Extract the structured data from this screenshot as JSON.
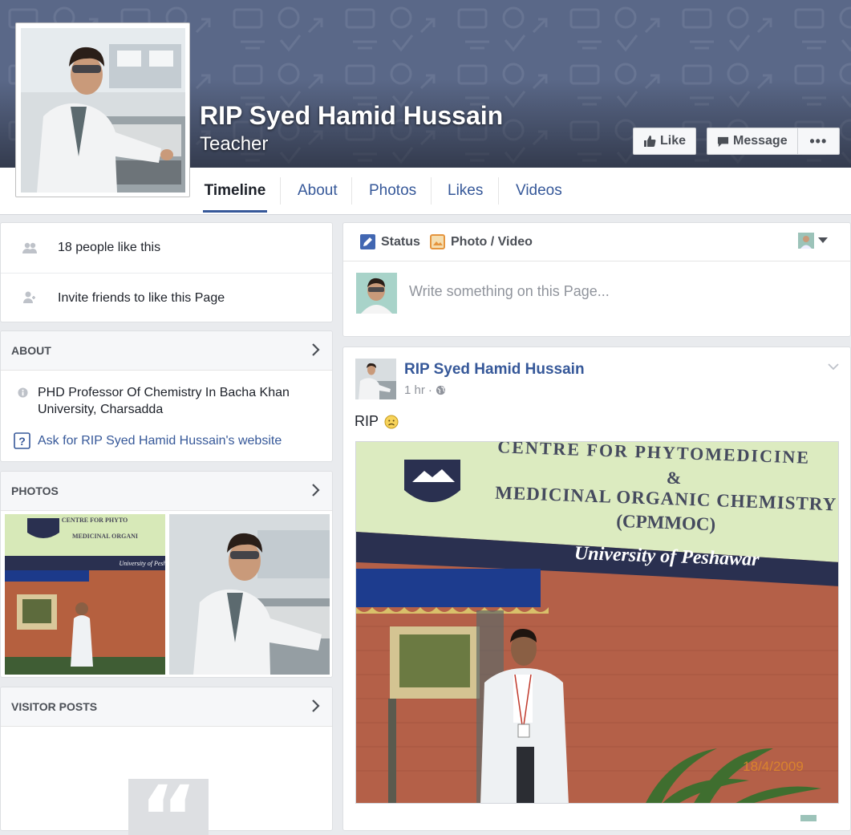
{
  "page": {
    "name": "RIP Syed Hamid Hussain",
    "category": "Teacher"
  },
  "cover_actions": {
    "like_label": "Like",
    "message_label": "Message",
    "more_label": "•••"
  },
  "tabs": [
    {
      "label": "Timeline",
      "active": true
    },
    {
      "label": "About",
      "active": false
    },
    {
      "label": "Photos",
      "active": false
    },
    {
      "label": "Likes",
      "active": false
    },
    {
      "label": "Videos",
      "active": false
    }
  ],
  "likes_card": {
    "likes_text": "18 people like this",
    "invite_text": "Invite friends to like this Page"
  },
  "about": {
    "title": "ABOUT",
    "description": "PHD Professor Of Chemistry In Bacha Khan University, Charsadda",
    "website_prompt": "Ask for RIP Syed Hamid Hussain's website"
  },
  "photos": {
    "title": "PHOTOS",
    "thumb1_banner": "CENTRE FOR PHYTO & MEDICINAL ORGANIC (CPMMO",
    "thumb1_sub": "University of Pesh"
  },
  "visitor_posts": {
    "title": "VISITOR POSTS",
    "quote_glyph": "“"
  },
  "composer": {
    "status_label": "Status",
    "photo_video_label": "Photo / Video",
    "placeholder": "Write something on this Page..."
  },
  "post": {
    "author": "RIP Syed Hamid Hussain",
    "time": "1 hr",
    "separator": "·",
    "text": "RIP",
    "banner_line1": "CENTRE FOR PHYTOMEDICINE",
    "banner_line2": "&",
    "banner_line3": "MEDICINAL ORGANIC CHEMISTRY",
    "banner_line4": "(CPMMOC)",
    "banner_university": "University of Peshawar",
    "photo_date": "18/4/2009"
  },
  "colors": {
    "link": "#365899",
    "cover": "#5a6888",
    "brick": "#b5603f",
    "banner_green": "#d7e9b8",
    "banner_navy": "#2a3050"
  }
}
